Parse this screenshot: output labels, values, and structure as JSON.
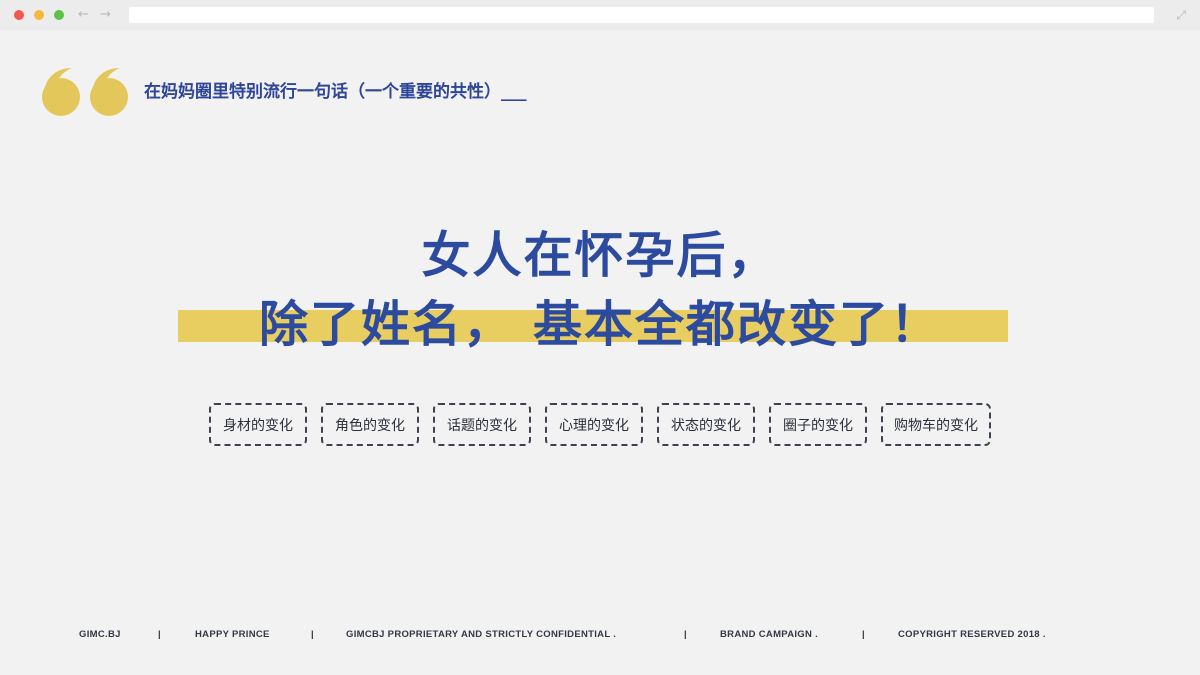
{
  "browser": {
    "back_arrow": "←",
    "forward_arrow": "→",
    "expand_glyph": "⤢",
    "icons": [
      "close-dot-icon",
      "minimize-dot-icon",
      "maximize-dot-icon",
      "back-arrow-icon",
      "forward-arrow-icon",
      "expand-icon"
    ]
  },
  "quote": {
    "icon": "quote-mark-icon",
    "color": "#e3c75a",
    "text": "在妈妈圈里特别流行一句话（一个重要的共性）___"
  },
  "headline": {
    "line1": "女人在怀孕后，",
    "line2": "除了姓名，  基本全都改变了！",
    "color": "#2d4b9e",
    "highlight_color": "#e8cd60"
  },
  "tags": [
    "身材的变化",
    "角色的变化",
    "话题的变化",
    "心理的变化",
    "状态的变化",
    "圈子的变化",
    "购物车的变化"
  ],
  "footer": {
    "items": [
      "GIMC.BJ",
      "HAPPY PRINCE",
      "GIMCBJ PROPRIETARY AND STRICTLY CONFIDENTIAL .",
      "BRAND CAMPAIGN .",
      "COPYRIGHT RESERVED 2018 ."
    ],
    "separator": "|"
  }
}
